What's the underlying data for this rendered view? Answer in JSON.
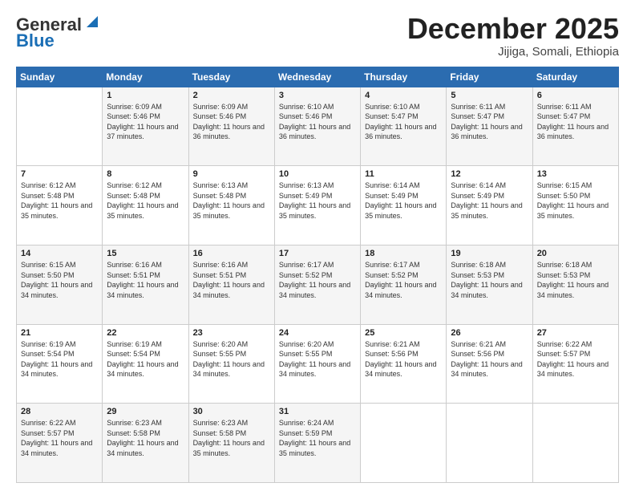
{
  "logo": {
    "general": "General",
    "blue": "Blue"
  },
  "header": {
    "month": "December 2025",
    "location": "Jijiga, Somali, Ethiopia"
  },
  "weekdays": [
    "Sunday",
    "Monday",
    "Tuesday",
    "Wednesday",
    "Thursday",
    "Friday",
    "Saturday"
  ],
  "weeks": [
    [
      {
        "day": "",
        "sunrise": "",
        "sunset": "",
        "daylight": ""
      },
      {
        "day": "1",
        "sunrise": "Sunrise: 6:09 AM",
        "sunset": "Sunset: 5:46 PM",
        "daylight": "Daylight: 11 hours and 37 minutes."
      },
      {
        "day": "2",
        "sunrise": "Sunrise: 6:09 AM",
        "sunset": "Sunset: 5:46 PM",
        "daylight": "Daylight: 11 hours and 36 minutes."
      },
      {
        "day": "3",
        "sunrise": "Sunrise: 6:10 AM",
        "sunset": "Sunset: 5:46 PM",
        "daylight": "Daylight: 11 hours and 36 minutes."
      },
      {
        "day": "4",
        "sunrise": "Sunrise: 6:10 AM",
        "sunset": "Sunset: 5:47 PM",
        "daylight": "Daylight: 11 hours and 36 minutes."
      },
      {
        "day": "5",
        "sunrise": "Sunrise: 6:11 AM",
        "sunset": "Sunset: 5:47 PM",
        "daylight": "Daylight: 11 hours and 36 minutes."
      },
      {
        "day": "6",
        "sunrise": "Sunrise: 6:11 AM",
        "sunset": "Sunset: 5:47 PM",
        "daylight": "Daylight: 11 hours and 36 minutes."
      }
    ],
    [
      {
        "day": "7",
        "sunrise": "Sunrise: 6:12 AM",
        "sunset": "Sunset: 5:48 PM",
        "daylight": "Daylight: 11 hours and 35 minutes."
      },
      {
        "day": "8",
        "sunrise": "Sunrise: 6:12 AM",
        "sunset": "Sunset: 5:48 PM",
        "daylight": "Daylight: 11 hours and 35 minutes."
      },
      {
        "day": "9",
        "sunrise": "Sunrise: 6:13 AM",
        "sunset": "Sunset: 5:48 PM",
        "daylight": "Daylight: 11 hours and 35 minutes."
      },
      {
        "day": "10",
        "sunrise": "Sunrise: 6:13 AM",
        "sunset": "Sunset: 5:49 PM",
        "daylight": "Daylight: 11 hours and 35 minutes."
      },
      {
        "day": "11",
        "sunrise": "Sunrise: 6:14 AM",
        "sunset": "Sunset: 5:49 PM",
        "daylight": "Daylight: 11 hours and 35 minutes."
      },
      {
        "day": "12",
        "sunrise": "Sunrise: 6:14 AM",
        "sunset": "Sunset: 5:49 PM",
        "daylight": "Daylight: 11 hours and 35 minutes."
      },
      {
        "day": "13",
        "sunrise": "Sunrise: 6:15 AM",
        "sunset": "Sunset: 5:50 PM",
        "daylight": "Daylight: 11 hours and 35 minutes."
      }
    ],
    [
      {
        "day": "14",
        "sunrise": "Sunrise: 6:15 AM",
        "sunset": "Sunset: 5:50 PM",
        "daylight": "Daylight: 11 hours and 34 minutes."
      },
      {
        "day": "15",
        "sunrise": "Sunrise: 6:16 AM",
        "sunset": "Sunset: 5:51 PM",
        "daylight": "Daylight: 11 hours and 34 minutes."
      },
      {
        "day": "16",
        "sunrise": "Sunrise: 6:16 AM",
        "sunset": "Sunset: 5:51 PM",
        "daylight": "Daylight: 11 hours and 34 minutes."
      },
      {
        "day": "17",
        "sunrise": "Sunrise: 6:17 AM",
        "sunset": "Sunset: 5:52 PM",
        "daylight": "Daylight: 11 hours and 34 minutes."
      },
      {
        "day": "18",
        "sunrise": "Sunrise: 6:17 AM",
        "sunset": "Sunset: 5:52 PM",
        "daylight": "Daylight: 11 hours and 34 minutes."
      },
      {
        "day": "19",
        "sunrise": "Sunrise: 6:18 AM",
        "sunset": "Sunset: 5:53 PM",
        "daylight": "Daylight: 11 hours and 34 minutes."
      },
      {
        "day": "20",
        "sunrise": "Sunrise: 6:18 AM",
        "sunset": "Sunset: 5:53 PM",
        "daylight": "Daylight: 11 hours and 34 minutes."
      }
    ],
    [
      {
        "day": "21",
        "sunrise": "Sunrise: 6:19 AM",
        "sunset": "Sunset: 5:54 PM",
        "daylight": "Daylight: 11 hours and 34 minutes."
      },
      {
        "day": "22",
        "sunrise": "Sunrise: 6:19 AM",
        "sunset": "Sunset: 5:54 PM",
        "daylight": "Daylight: 11 hours and 34 minutes."
      },
      {
        "day": "23",
        "sunrise": "Sunrise: 6:20 AM",
        "sunset": "Sunset: 5:55 PM",
        "daylight": "Daylight: 11 hours and 34 minutes."
      },
      {
        "day": "24",
        "sunrise": "Sunrise: 6:20 AM",
        "sunset": "Sunset: 5:55 PM",
        "daylight": "Daylight: 11 hours and 34 minutes."
      },
      {
        "day": "25",
        "sunrise": "Sunrise: 6:21 AM",
        "sunset": "Sunset: 5:56 PM",
        "daylight": "Daylight: 11 hours and 34 minutes."
      },
      {
        "day": "26",
        "sunrise": "Sunrise: 6:21 AM",
        "sunset": "Sunset: 5:56 PM",
        "daylight": "Daylight: 11 hours and 34 minutes."
      },
      {
        "day": "27",
        "sunrise": "Sunrise: 6:22 AM",
        "sunset": "Sunset: 5:57 PM",
        "daylight": "Daylight: 11 hours and 34 minutes."
      }
    ],
    [
      {
        "day": "28",
        "sunrise": "Sunrise: 6:22 AM",
        "sunset": "Sunset: 5:57 PM",
        "daylight": "Daylight: 11 hours and 34 minutes."
      },
      {
        "day": "29",
        "sunrise": "Sunrise: 6:23 AM",
        "sunset": "Sunset: 5:58 PM",
        "daylight": "Daylight: 11 hours and 34 minutes."
      },
      {
        "day": "30",
        "sunrise": "Sunrise: 6:23 AM",
        "sunset": "Sunset: 5:58 PM",
        "daylight": "Daylight: 11 hours and 35 minutes."
      },
      {
        "day": "31",
        "sunrise": "Sunrise: 6:24 AM",
        "sunset": "Sunset: 5:59 PM",
        "daylight": "Daylight: 11 hours and 35 minutes."
      },
      {
        "day": "",
        "sunrise": "",
        "sunset": "",
        "daylight": ""
      },
      {
        "day": "",
        "sunrise": "",
        "sunset": "",
        "daylight": ""
      },
      {
        "day": "",
        "sunrise": "",
        "sunset": "",
        "daylight": ""
      }
    ]
  ]
}
